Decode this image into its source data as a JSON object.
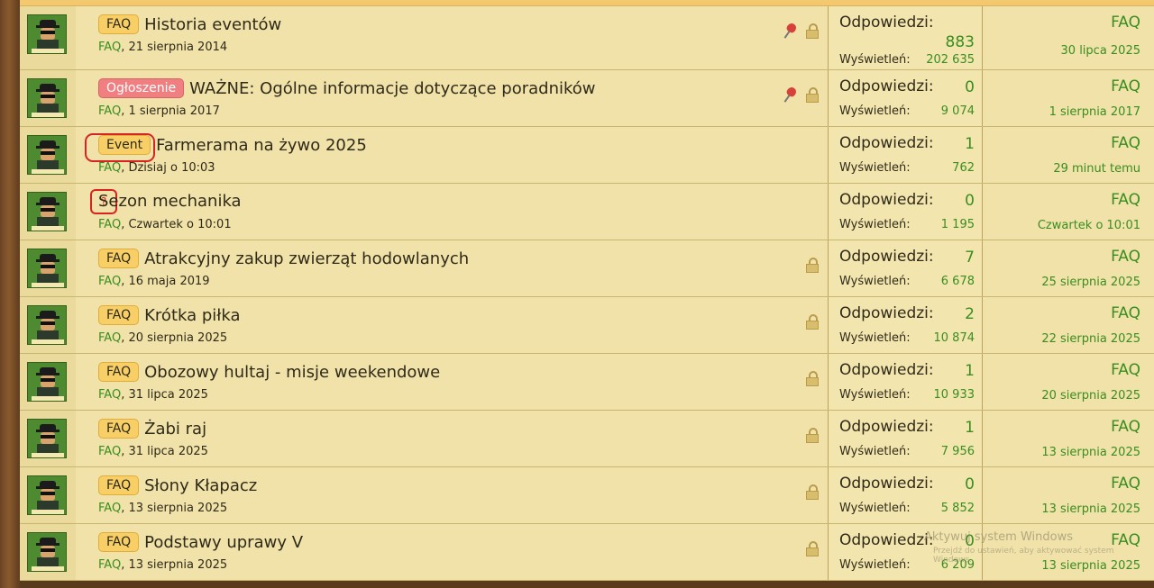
{
  "threads": [
    {
      "prefix": "FAQ",
      "prefix_style": "faq",
      "title": "Historia eventów",
      "author": "FAQ",
      "date": "21 sierpnia 2014",
      "pinned": true,
      "locked": true,
      "replies_label": "Odpowiedzi:",
      "replies": "883",
      "views_label": "Wyświetleń:",
      "views": "202 635",
      "last_author": "FAQ",
      "last_date": "30 lipca 2025"
    },
    {
      "prefix": "Ogłoszenie",
      "prefix_style": "ann",
      "title": "WAŻNE: Ogólne informacje dotyczące poradników",
      "author": "FAQ",
      "date": "1 sierpnia 2017",
      "pinned": true,
      "locked": true,
      "replies_label": "Odpowiedzi:",
      "replies": "0",
      "views_label": "Wyświetleń:",
      "views": "9 074",
      "last_author": "FAQ",
      "last_date": "1 sierpnia 2017"
    },
    {
      "prefix": "Event",
      "prefix_style": "event",
      "title": "Farmerama na żywo 2025",
      "author": "FAQ",
      "date": "Dzisiaj o 10:03",
      "pinned": false,
      "locked": false,
      "replies_label": "Odpowiedzi:",
      "replies": "1",
      "views_label": "Wyświetleń:",
      "views": "762",
      "last_author": "FAQ",
      "last_date": "29 minut temu"
    },
    {
      "prefix": "?",
      "prefix_style": "q",
      "title": "Sezon mechanika",
      "author": "FAQ",
      "date": "Czwartek o 10:01",
      "pinned": false,
      "locked": false,
      "replies_label": "Odpowiedzi:",
      "replies": "0",
      "views_label": "Wyświetleń:",
      "views": "1 195",
      "last_author": "FAQ",
      "last_date": "Czwartek o 10:01"
    },
    {
      "prefix": "FAQ",
      "prefix_style": "faq",
      "title": "Atrakcyjny zakup zwierząt hodowlanych",
      "author": "FAQ",
      "date": "16 maja 2019",
      "pinned": false,
      "locked": true,
      "replies_label": "Odpowiedzi:",
      "replies": "7",
      "views_label": "Wyświetleń:",
      "views": "6 678",
      "last_author": "FAQ",
      "last_date": "25 sierpnia 2025"
    },
    {
      "prefix": "FAQ",
      "prefix_style": "faq",
      "title": "Krótka piłka",
      "author": "FAQ",
      "date": "20 sierpnia 2025",
      "pinned": false,
      "locked": true,
      "replies_label": "Odpowiedzi:",
      "replies": "2",
      "views_label": "Wyświetleń:",
      "views": "10 874",
      "last_author": "FAQ",
      "last_date": "22 sierpnia 2025"
    },
    {
      "prefix": "FAQ",
      "prefix_style": "faq",
      "title": "Obozowy hultaj - misje weekendowe",
      "author": "FAQ",
      "date": "31 lipca 2025",
      "pinned": false,
      "locked": true,
      "replies_label": "Odpowiedzi:",
      "replies": "1",
      "views_label": "Wyświetleń:",
      "views": "10 933",
      "last_author": "FAQ",
      "last_date": "20 sierpnia 2025"
    },
    {
      "prefix": "FAQ",
      "prefix_style": "faq",
      "title": "Żabi raj",
      "author": "FAQ",
      "date": "31 lipca 2025",
      "pinned": false,
      "locked": true,
      "replies_label": "Odpowiedzi:",
      "replies": "1",
      "views_label": "Wyświetleń:",
      "views": "7 956",
      "last_author": "FAQ",
      "last_date": "13 sierpnia 2025"
    },
    {
      "prefix": "FAQ",
      "prefix_style": "faq",
      "title": "Słony Kłapacz",
      "author": "FAQ",
      "date": "13 sierpnia 2025",
      "pinned": false,
      "locked": true,
      "replies_label": "Odpowiedzi:",
      "replies": "0",
      "views_label": "Wyświetleń:",
      "views": "5 852",
      "last_author": "FAQ",
      "last_date": "13 sierpnia 2025"
    },
    {
      "prefix": "FAQ",
      "prefix_style": "faq",
      "title": "Podstawy uprawy V",
      "author": "FAQ",
      "date": "13 sierpnia 2025",
      "pinned": false,
      "locked": true,
      "replies_label": "Odpowiedzi:",
      "replies": "0",
      "views_label": "Wyświetleń:",
      "views": "6 209",
      "last_author": "FAQ",
      "last_date": "13 sierpnia 2025"
    }
  ],
  "watermark": {
    "line1": "Aktywuj system Windows",
    "line2": "Przejdź do ustawień, aby aktywować system Windows."
  },
  "colors": {
    "accent_green": "#3a8e1f",
    "row_bg": "#f0e2a9",
    "badge_faq": "#f7cf66",
    "badge_announcement": "#f07f82",
    "annotation_red": "#d92323"
  }
}
